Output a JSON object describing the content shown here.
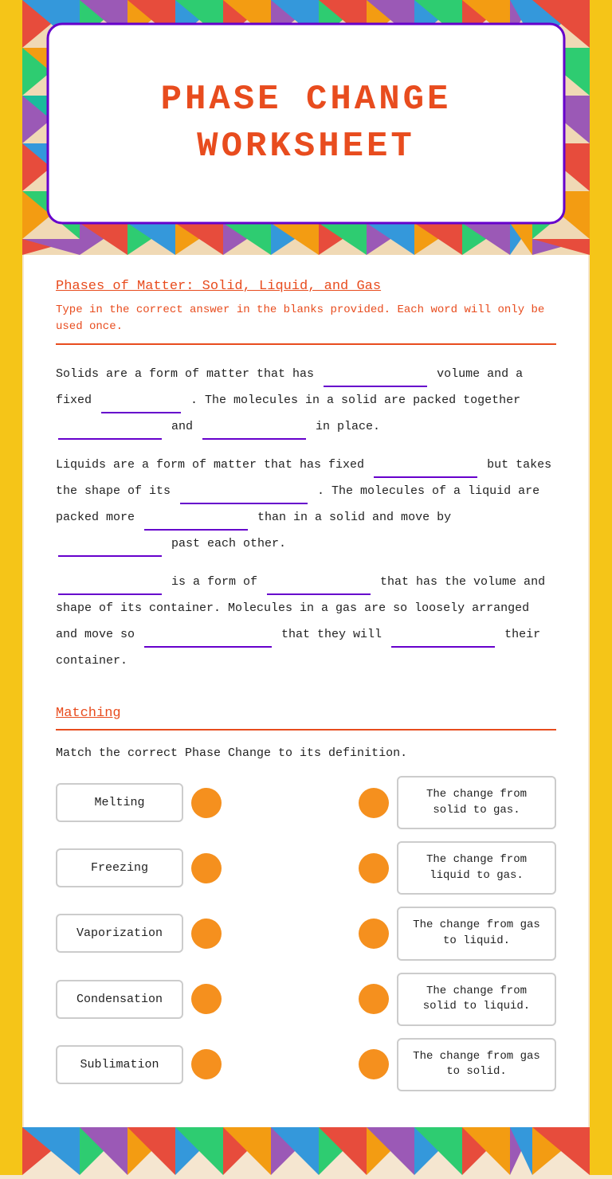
{
  "page": {
    "title": "Phase Change Worksheet",
    "background_color": "#f5e6d0"
  },
  "header": {
    "title_line1": "PHASE CHANGE",
    "title_line2": "WORKSHEET"
  },
  "section1": {
    "title": "Phases of Matter:  Solid, Liquid, and Gas",
    "instructions": "Type in the correct answer in the blanks provided.  Each word will only be used once.",
    "paragraph1_pre": "Solids are a form of matter that has",
    "paragraph1_mid1": "volume and a fixed",
    "paragraph1_mid2": ". The molecules in a solid are packed together",
    "paragraph1_mid3": "and",
    "paragraph1_end": "in place.",
    "paragraph2_pre": "Liquids are a form of matter that has fixed",
    "paragraph2_mid1": "but takes the shape of its",
    "paragraph2_mid2": ". The molecules of a liquid are packed more",
    "paragraph2_mid3": "than in a solid and move by",
    "paragraph2_end": "past each other.",
    "paragraph3_pre1": "",
    "paragraph3_pre2": "is a form of",
    "paragraph3_mid1": "that has the volume and shape of its container. Molecules in a gas are so loosely arranged and move so",
    "paragraph3_mid2": "that they will",
    "paragraph3_end": "their container."
  },
  "section2": {
    "title": "Matching",
    "instruction": "Match the correct Phase Change to its definition.",
    "items": [
      {
        "term": "Melting",
        "definition": "The change from solid to gas."
      },
      {
        "term": "Freezing",
        "definition": "The change from liquid to gas."
      },
      {
        "term": "Vaporization",
        "definition": "The change from gas to liquid."
      },
      {
        "term": "Condensation",
        "definition": "The change from solid to liquid."
      },
      {
        "term": "Sublimation",
        "definition": "The change from gas to solid."
      }
    ]
  },
  "colors": {
    "orange_circle": "#f5901e",
    "title_color": "#e84c1e",
    "border_color": "#6600cc",
    "accent_red": "#e84c1e",
    "yellow_strip": "#f5c518"
  }
}
